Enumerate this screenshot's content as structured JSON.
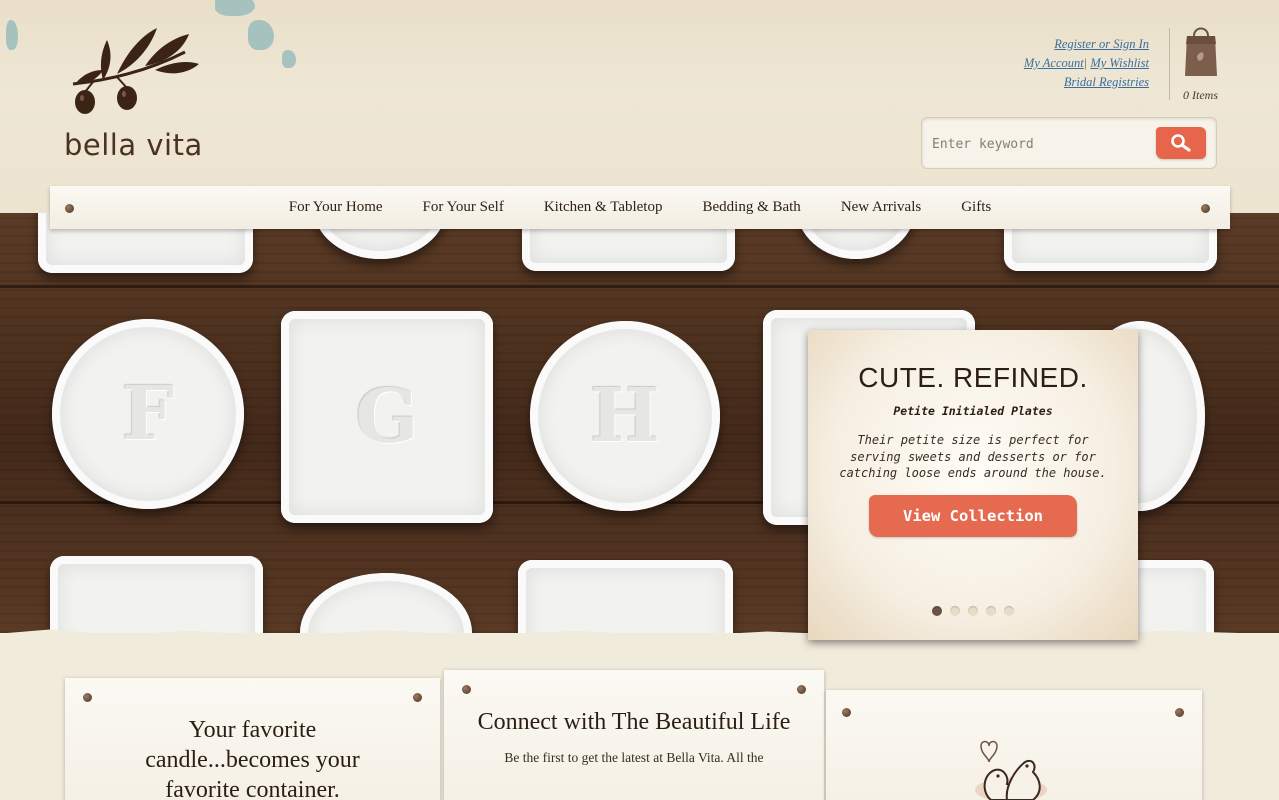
{
  "brand": {
    "name": "bella vita"
  },
  "account": {
    "register_signin": "Register or Sign In",
    "my_account": "My Account",
    "separator": "|",
    "my_wishlist": "My Wishlist",
    "bridal_registries": "Bridal Registries"
  },
  "cart": {
    "count_label": "0 Items",
    "icon": "shopping-bag-icon"
  },
  "search": {
    "placeholder": "Enter keyword",
    "icon": "magnifier-icon"
  },
  "nav": {
    "items": [
      "For Your Home",
      "For Your Self",
      "Kitchen & Tabletop",
      "Bedding & Bath",
      "New Arrivals",
      "Gifts"
    ]
  },
  "hero": {
    "plate_letters": [
      "F",
      "G",
      "H"
    ],
    "promo": {
      "title": "CUTE. REFINED.",
      "subtitle": "Petite Initialed Plates",
      "body": "Their petite size is perfect for serving sweets and desserts or for catching loose ends around the house.",
      "button": "View Collection",
      "slides_total": 5,
      "active_slide": 1
    }
  },
  "cards": [
    {
      "title": "Your favorite candle...becomes your favorite container."
    },
    {
      "title": "Connect with The Beautiful Life",
      "text": "Be the first to get the latest at Bella Vita. All the"
    },
    {
      "image": "love-birds-icon"
    }
  ],
  "colors": {
    "accent": "#e56a4f",
    "link": "#3a6f9d",
    "wood": "#4e321f",
    "paper": "#f1ebdc"
  }
}
